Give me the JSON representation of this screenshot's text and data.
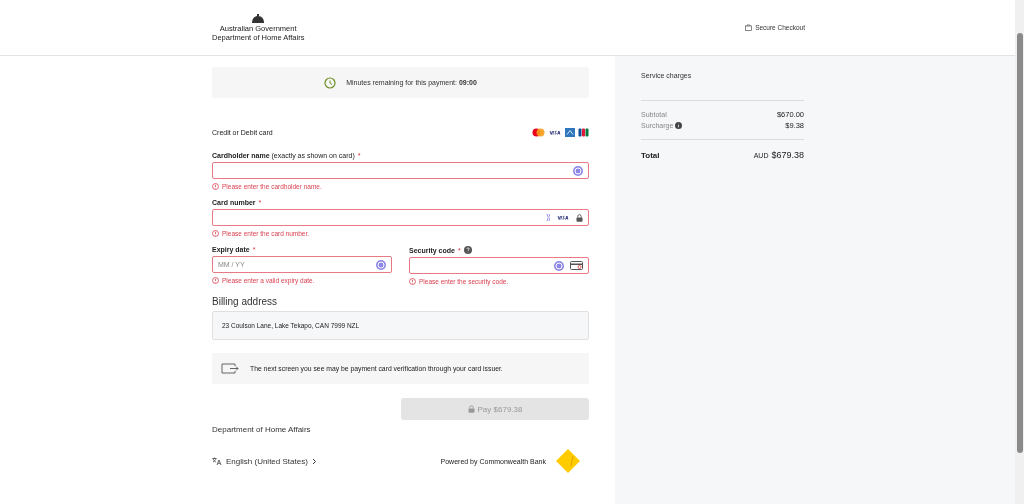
{
  "header": {
    "logo_lines": [
      "Australian Government",
      "Department of Home Affairs"
    ],
    "secure_label": "Secure Checkout"
  },
  "timer": {
    "label": "Minutes remaining for this payment:",
    "value": "09:00"
  },
  "payment_method": {
    "title": "Credit or Debit card",
    "brands": [
      {
        "kind": "mastercard"
      },
      {
        "kind": "visa"
      },
      {
        "kind": "amex"
      },
      {
        "kind": "jcb"
      }
    ]
  },
  "fields": [
    {
      "label": "Cardholder name",
      "hint": "(exactly as shown on card)",
      "required_mark": "*",
      "invalid": true,
      "error": "Please enter the cardholder name.",
      "kind": "name"
    },
    {
      "label": "Card number",
      "required_mark": "*",
      "invalid": true,
      "error": "Please enter the card number.",
      "kind": "card"
    },
    {
      "label": "Expiry date",
      "required_mark": "*",
      "invalid": true,
      "error": "Please enter a valid expiry date.",
      "placeholder": "MM / YY",
      "kind": "expiry"
    },
    {
      "label": "Security code",
      "required_mark": "*",
      "invalid": true,
      "error": "Please enter the security code.",
      "kind": "cvc",
      "help": true
    }
  ],
  "billing": {
    "title": "Billing address",
    "address": "23 Coulson Lane, Lake Tekapo, CAN 7999 NZL"
  },
  "notice": "The next screen you see may be payment card verification through your card issuer.",
  "pay_button": {
    "label": "Pay $679.38",
    "disabled": true
  },
  "footer": {
    "department": "Department of Home Affairs",
    "language": "English (United States)",
    "powered_by": "Powered by Commonwealth Bank"
  },
  "summary": {
    "title": "Service charges",
    "rows": [
      {
        "label": "Subtotal",
        "value": "$670.00",
        "info": false
      },
      {
        "label": "Surcharge",
        "value": "$9.38",
        "info": true
      }
    ],
    "total_label": "Total",
    "currency": "AUD",
    "total": "$679.38"
  }
}
